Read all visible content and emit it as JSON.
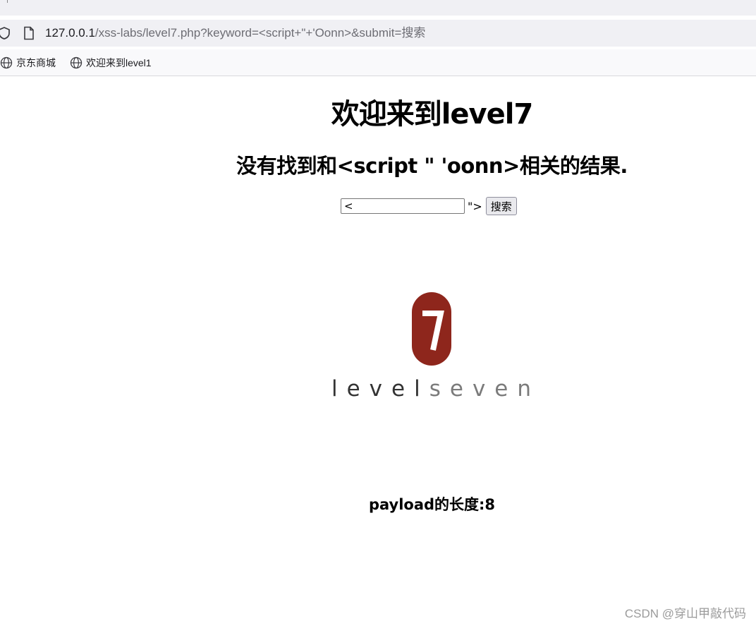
{
  "browser": {
    "url_host": "127.0.0.1",
    "url_path": "/xss-labs/level7.php?keyword=<script+\"+'Oonn>&submit=搜索",
    "bookmarks": [
      "京东商城",
      "欢迎来到level1"
    ]
  },
  "page": {
    "title": "欢迎来到level7",
    "result_message": "没有找到和<script \" 'oonn>相关的结果.",
    "search": {
      "value": "<",
      "leaked_text": "\">",
      "button_label": "搜索"
    },
    "logo": {
      "badge_number": "7",
      "word_part1": "level",
      "word_part2": "seven",
      "badge_color": "#8e261c"
    },
    "payload_length": "payload的长度:8"
  },
  "watermark": "CSDN @穿山甲敲代码"
}
